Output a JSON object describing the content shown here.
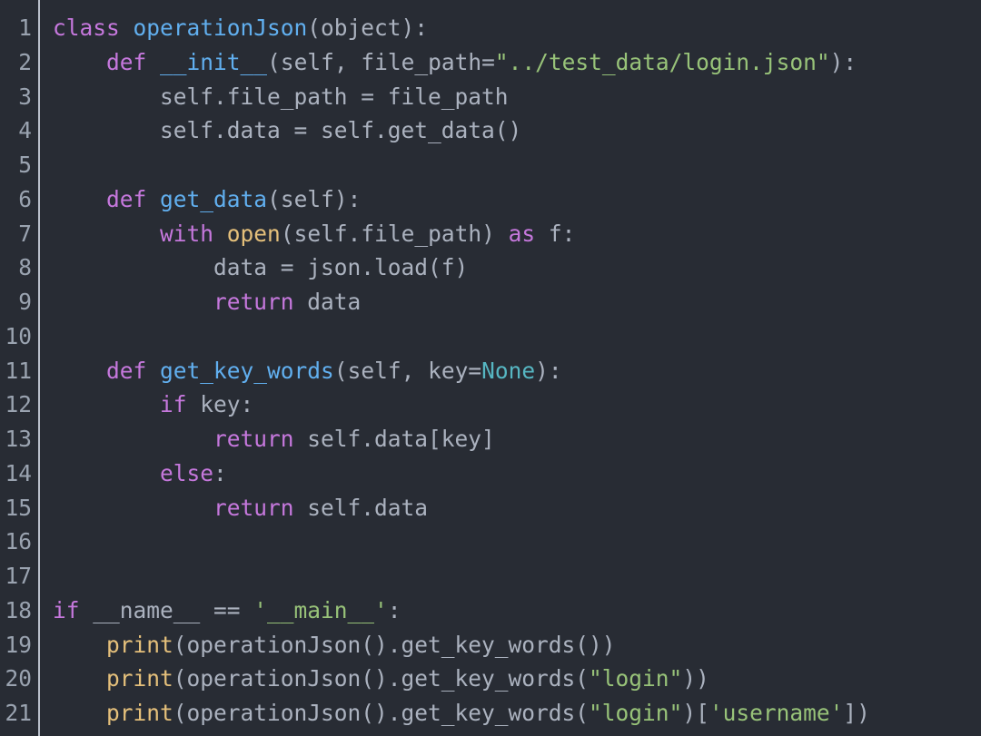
{
  "editor": {
    "language": "python",
    "theme": "one-dark",
    "background": "#282c34",
    "gutter_background": "#282c34",
    "gutter_separator_color": "#b9bfca",
    "line_number_color": "#9aa3b0",
    "default_text_color": "#abb2bf",
    "first_line_number": 1,
    "last_line_number": 21,
    "total_lines": 21
  },
  "colors": {
    "keyword": "#c678dd",
    "function": "#61afef",
    "builtin": "#e5c07b",
    "string": "#98c379",
    "constant": "#56b6c2",
    "default": "#abb2bf"
  },
  "line_numbers": [
    "1",
    "2",
    "3",
    "4",
    "5",
    "6",
    "7",
    "8",
    "9",
    "10",
    "11",
    "12",
    "13",
    "14",
    "15",
    "16",
    "17",
    "18",
    "19",
    "20",
    "21"
  ],
  "code_lines": [
    {
      "number": "1",
      "text": "class operationJson(object):",
      "tokens": [
        {
          "t": "class",
          "c": "kw"
        },
        {
          "t": " ",
          "c": "def"
        },
        {
          "t": "operationJson",
          "c": "fn"
        },
        {
          "t": "(object):",
          "c": "def"
        }
      ]
    },
    {
      "number": "2",
      "text": "    def __init__(self, file_path=\"../test_data/login.json\"):",
      "tokens": [
        {
          "t": "    ",
          "c": "def"
        },
        {
          "t": "def",
          "c": "kw"
        },
        {
          "t": " ",
          "c": "def"
        },
        {
          "t": "__init__",
          "c": "fn"
        },
        {
          "t": "(self, file_path=",
          "c": "def"
        },
        {
          "t": "\"../test_data/login.json\"",
          "c": "str"
        },
        {
          "t": "):",
          "c": "def"
        }
      ]
    },
    {
      "number": "3",
      "text": "        self.file_path = file_path",
      "tokens": [
        {
          "t": "        self.file_path = file_path",
          "c": "def"
        }
      ]
    },
    {
      "number": "4",
      "text": "        self.data = self.get_data()",
      "tokens": [
        {
          "t": "        self.data = self.get_data()",
          "c": "def"
        }
      ]
    },
    {
      "number": "5",
      "text": "",
      "tokens": []
    },
    {
      "number": "6",
      "text": "    def get_data(self):",
      "tokens": [
        {
          "t": "    ",
          "c": "def"
        },
        {
          "t": "def",
          "c": "kw"
        },
        {
          "t": " ",
          "c": "def"
        },
        {
          "t": "get_data",
          "c": "fn"
        },
        {
          "t": "(self):",
          "c": "def"
        }
      ]
    },
    {
      "number": "7",
      "text": "        with open(self.file_path) as f:",
      "tokens": [
        {
          "t": "        ",
          "c": "def"
        },
        {
          "t": "with",
          "c": "kw"
        },
        {
          "t": " ",
          "c": "def"
        },
        {
          "t": "open",
          "c": "bi"
        },
        {
          "t": "(self.file_path) ",
          "c": "def"
        },
        {
          "t": "as",
          "c": "kw"
        },
        {
          "t": " f:",
          "c": "def"
        }
      ]
    },
    {
      "number": "8",
      "text": "            data = json.load(f)",
      "tokens": [
        {
          "t": "            data = json.load(f)",
          "c": "def"
        }
      ]
    },
    {
      "number": "9",
      "text": "            return data",
      "tokens": [
        {
          "t": "            ",
          "c": "def"
        },
        {
          "t": "return",
          "c": "kw"
        },
        {
          "t": " data",
          "c": "def"
        }
      ]
    },
    {
      "number": "10",
      "text": "",
      "tokens": []
    },
    {
      "number": "11",
      "text": "    def get_key_words(self, key=None):",
      "tokens": [
        {
          "t": "    ",
          "c": "def"
        },
        {
          "t": "def",
          "c": "kw"
        },
        {
          "t": " ",
          "c": "def"
        },
        {
          "t": "get_key_words",
          "c": "fn"
        },
        {
          "t": "(self, key=",
          "c": "def"
        },
        {
          "t": "None",
          "c": "const"
        },
        {
          "t": "):",
          "c": "def"
        }
      ]
    },
    {
      "number": "12",
      "text": "        if key:",
      "tokens": [
        {
          "t": "        ",
          "c": "def"
        },
        {
          "t": "if",
          "c": "kw"
        },
        {
          "t": " key:",
          "c": "def"
        }
      ]
    },
    {
      "number": "13",
      "text": "            return self.data[key]",
      "tokens": [
        {
          "t": "            ",
          "c": "def"
        },
        {
          "t": "return",
          "c": "kw"
        },
        {
          "t": " self.data[key]",
          "c": "def"
        }
      ]
    },
    {
      "number": "14",
      "text": "        else:",
      "tokens": [
        {
          "t": "        ",
          "c": "def"
        },
        {
          "t": "else",
          "c": "kw"
        },
        {
          "t": ":",
          "c": "def"
        }
      ]
    },
    {
      "number": "15",
      "text": "            return self.data",
      "tokens": [
        {
          "t": "            ",
          "c": "def"
        },
        {
          "t": "return",
          "c": "kw"
        },
        {
          "t": " self.data",
          "c": "def"
        }
      ]
    },
    {
      "number": "16",
      "text": "",
      "tokens": []
    },
    {
      "number": "17",
      "text": "",
      "tokens": []
    },
    {
      "number": "18",
      "text": "if __name__ == '__main__':",
      "tokens": [
        {
          "t": "if",
          "c": "kw"
        },
        {
          "t": " __name__ == ",
          "c": "def"
        },
        {
          "t": "'__main__'",
          "c": "str"
        },
        {
          "t": ":",
          "c": "def"
        }
      ]
    },
    {
      "number": "19",
      "text": "    print(operationJson().get_key_words())",
      "tokens": [
        {
          "t": "    ",
          "c": "def"
        },
        {
          "t": "print",
          "c": "bi"
        },
        {
          "t": "(operationJson().get_key_words())",
          "c": "def"
        }
      ]
    },
    {
      "number": "20",
      "text": "    print(operationJson().get_key_words(\"login\"))",
      "tokens": [
        {
          "t": "    ",
          "c": "def"
        },
        {
          "t": "print",
          "c": "bi"
        },
        {
          "t": "(operationJson().get_key_words(",
          "c": "def"
        },
        {
          "t": "\"login\"",
          "c": "str"
        },
        {
          "t": "))",
          "c": "def"
        }
      ]
    },
    {
      "number": "21",
      "text": "    print(operationJson().get_key_words(\"login\")['username'])",
      "tokens": [
        {
          "t": "    ",
          "c": "def"
        },
        {
          "t": "print",
          "c": "bi"
        },
        {
          "t": "(operationJson().get_key_words(",
          "c": "def"
        },
        {
          "t": "\"login\"",
          "c": "str"
        },
        {
          "t": ")[",
          "c": "def"
        },
        {
          "t": "'username'",
          "c": "str"
        },
        {
          "t": "])",
          "c": "def"
        }
      ]
    }
  ]
}
